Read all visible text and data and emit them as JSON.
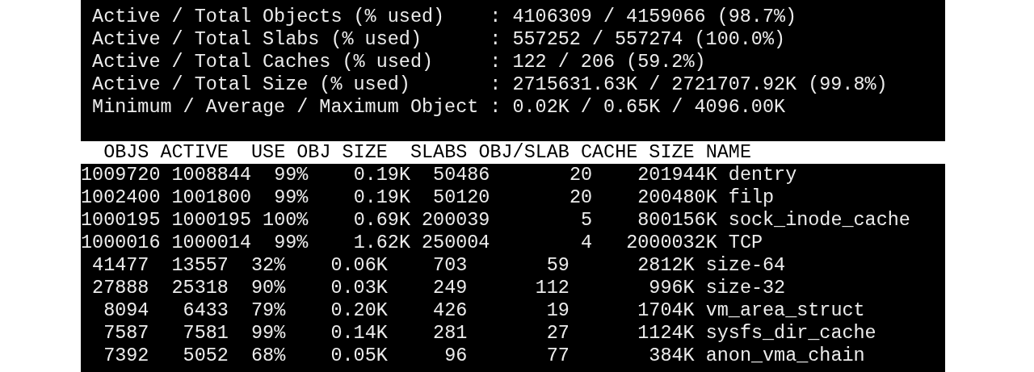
{
  "summary": [
    "Active / Total Objects (% used)    : 4106309 / 4159066 (98.7%)",
    "Active / Total Slabs (% used)      : 557252 / 557274 (100.0%)",
    "Active / Total Caches (% used)     : 122 / 206 (59.2%)",
    "Active / Total Size (% used)       : 2715631.63K / 2721707.92K (99.8%)",
    "Minimum / Average / Maximum Object : 0.02K / 0.65K / 4096.00K"
  ],
  "table": {
    "columns": [
      "OBJS",
      "ACTIVE",
      "USE",
      "OBJ SIZE",
      "SLABS",
      "OBJ/SLAB",
      "CACHE SIZE",
      "NAME"
    ],
    "rows": [
      [
        "1009720",
        "1008844",
        "99%",
        "0.19K",
        "50486",
        "20",
        "201944K",
        "dentry"
      ],
      [
        "1002400",
        "1001800",
        "99%",
        "0.19K",
        "50120",
        "20",
        "200480K",
        "filp"
      ],
      [
        "1000195",
        "1000195",
        "100%",
        "0.69K",
        "200039",
        "5",
        "800156K",
        "sock_inode_cache"
      ],
      [
        "1000016",
        "1000014",
        "99%",
        "1.62K",
        "250004",
        "4",
        "2000032K",
        "TCP"
      ],
      [
        "41477",
        "13557",
        "32%",
        "0.06K",
        "703",
        "59",
        "2812K",
        "size-64"
      ],
      [
        "27888",
        "25318",
        "90%",
        "0.03K",
        "249",
        "112",
        "996K",
        "size-32"
      ],
      [
        "8094",
        "6433",
        "79%",
        "0.20K",
        "426",
        "19",
        "1704K",
        "vm_area_struct"
      ],
      [
        "7587",
        "7581",
        "99%",
        "0.14K",
        "281",
        "27",
        "1124K",
        "sysfs_dir_cache"
      ],
      [
        "7392",
        "5052",
        "68%",
        "0.05K",
        "96",
        "77",
        "384K",
        "anon_vma_chain"
      ]
    ]
  }
}
